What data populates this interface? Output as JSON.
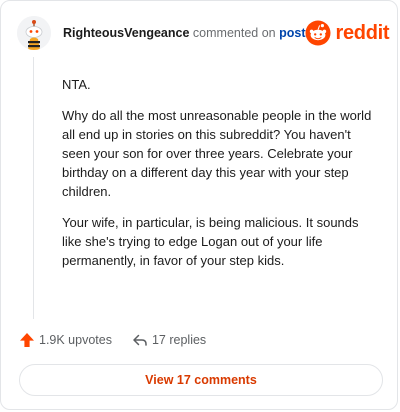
{
  "comment": {
    "username": "RighteousVengeance",
    "action_text": "commented on",
    "post_link": "post",
    "paragraphs": [
      "NTA.",
      "Why do all the most unreasonable people in the world all end up in stories on this subreddit? You haven't seen your son for over three years. Celebrate your birthday on a different day this year with your step children.",
      "Your wife, in particular, is being malicious. It sounds like she's trying to edge Logan out of your life permanently, in favor of your step kids."
    ]
  },
  "brand": {
    "wordmark": "reddit",
    "icon": "reddit-alien-logo",
    "color": "#ff4500"
  },
  "footer": {
    "upvotes": "1.9K upvotes",
    "replies": "17 replies",
    "upvote_icon": "arrow-up-icon",
    "reply_icon": "reply-arrow-icon",
    "upvote_color": "#ff4500"
  },
  "cta": {
    "label": "View 17 comments",
    "color": "#d93a00"
  }
}
